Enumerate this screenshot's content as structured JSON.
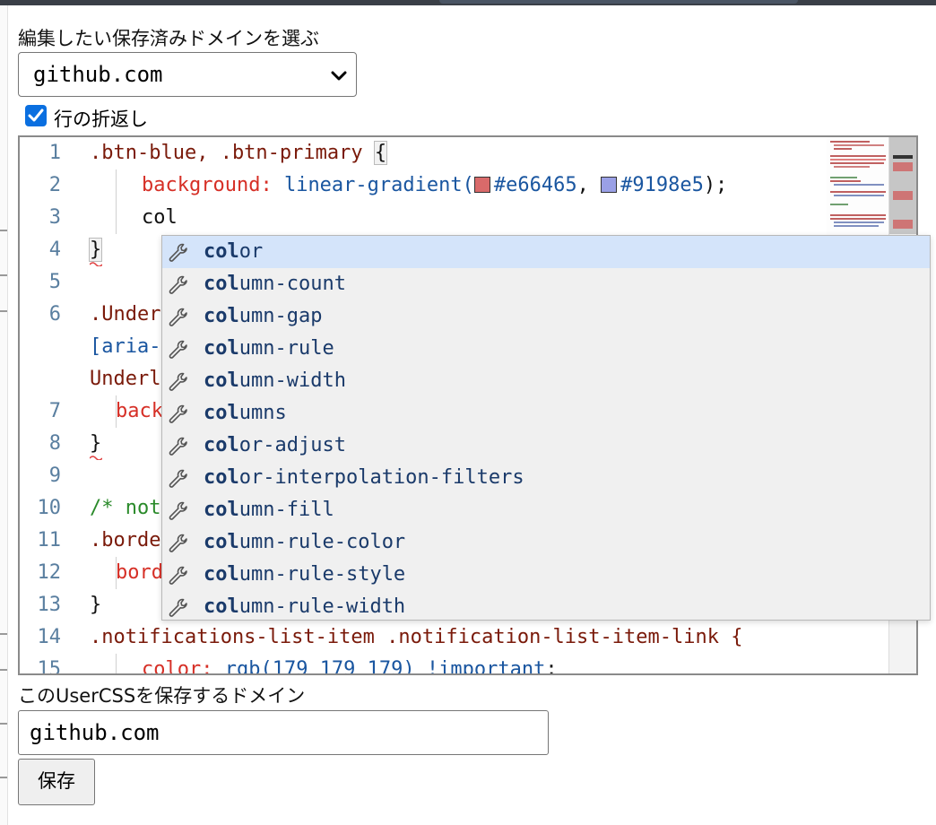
{
  "domain_select": {
    "label": "編集したい保存済みドメインを選ぶ",
    "value": "github.com"
  },
  "wrap_checkbox": {
    "label": "行の折返し",
    "checked": true
  },
  "editor": {
    "line_numbers": [
      "1",
      "2",
      "3",
      "4",
      "5",
      "6",
      "7",
      "8",
      "9",
      "10",
      "11",
      "12",
      "13",
      "14",
      "15"
    ],
    "lines": {
      "l1_selector": ".btn-blue, .btn-primary ",
      "l1_brace": "{",
      "l2_prop": "background:",
      "l2_fn": " linear-gradient(",
      "l2_color1": "#e66465",
      "l2_sep": ", ",
      "l2_color2": "#9198e5",
      "l2_end": ");",
      "l3_text": "col",
      "l4_text": "}",
      "l6a": ".Under",
      "l6b": "[aria-",
      "l6c": "Underl",
      "l7": "back",
      "l8": "}",
      "l10": "/* not",
      "l11": ".borde",
      "l12": "bord",
      "l13": "}",
      "l14": ".notifications-list-item .notification-list-item-link {",
      "l15_prop": "color:",
      "l15_fn": " rgb(179 179 179)",
      "l15_imp": " !important",
      "l15_end": ";"
    },
    "swatch_colors": [
      "#d96a6a",
      "#9aa0e6"
    ]
  },
  "autocomplete": {
    "typed": "col",
    "items": [
      {
        "match": "col",
        "rest": "or"
      },
      {
        "match": "col",
        "rest": "umn-count"
      },
      {
        "match": "col",
        "rest": "umn-gap"
      },
      {
        "match": "col",
        "rest": "umn-rule"
      },
      {
        "match": "col",
        "rest": "umn-width"
      },
      {
        "match": "col",
        "rest": "umns"
      },
      {
        "match": "col",
        "rest": "or-adjust"
      },
      {
        "match": "col",
        "rest": "or-interpolation-filters"
      },
      {
        "match": "col",
        "rest": "umn-fill"
      },
      {
        "match": "col",
        "rest": "umn-rule-color"
      },
      {
        "match": "col",
        "rest": "umn-rule-style"
      },
      {
        "match": "col",
        "rest": "umn-rule-width"
      }
    ],
    "selected_index": 0,
    "icon": "wrench-icon"
  },
  "save_domain": {
    "label": "このUserCSSを保存するドメイン",
    "value": "github.com"
  },
  "save_button": {
    "label": "保存"
  },
  "colors": {
    "accent": "#0a6fe0",
    "selector": "#7a1a0a",
    "property": "#d62f26",
    "value": "#1a56a0",
    "comment": "#2a8a2a",
    "line_number": "#5a7fa0",
    "suggestion_highlight": "#d4e4fa"
  }
}
